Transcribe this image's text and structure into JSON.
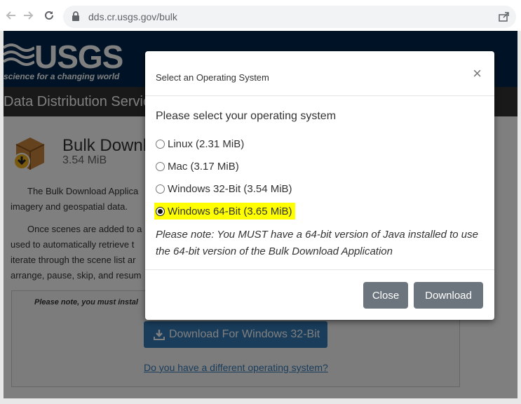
{
  "browser": {
    "url": "dds.cr.usgs.gov/bulk"
  },
  "page": {
    "logo_text": "USGS",
    "logo_tagline": "science for a changing world",
    "nav_title": "Data Distribution Servic",
    "title": "Bulk Downl",
    "size": "3.54 MiB",
    "para1_lines": [
      "The Bulk Download Applica",
      "imagery and geospatial data."
    ],
    "para2_lines": [
      "Once scenes are added to a",
      "used to automatically retrieve t",
      "iterate through the scene list ar",
      "arrange, pause, skip, and resum"
    ],
    "note_text": "Please note, you must instal",
    "download_button": "Download For Windows 32-Bit",
    "alt_link": "Do you have a different operating system?"
  },
  "modal": {
    "title": "Select an Operating System",
    "close_glyph": "×",
    "prompt": "Please select your operating system",
    "options": [
      {
        "label": "Linux (2.31 MiB)",
        "selected": false
      },
      {
        "label": "Mac (3.17 MiB)",
        "selected": false
      },
      {
        "label": "Windows 32-Bit (3.54 MiB)",
        "selected": false
      },
      {
        "label": "Windows 64-Bit (3.65 MiB)",
        "selected": true
      }
    ],
    "note": "Please note: You MUST have a 64-bit version of Java installed to use the 64-bit version of the Bulk Download Application",
    "close_button": "Close",
    "download_button": "Download"
  },
  "colors": {
    "highlight": "#ffff00",
    "button_gray": "#6c757d",
    "header_navy": "#00264c",
    "link_blue": "#337ab7"
  }
}
